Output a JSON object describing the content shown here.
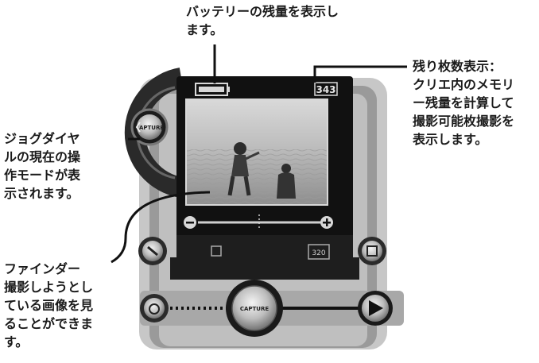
{
  "annotations": {
    "battery": "バッテリーの残量を表示し\nます。",
    "remaining": "残り枚数表示：\nクリエ内のメモリ\nー残量を計算して\n撮影可能枚撮影を\n表示します。",
    "jog_dial": "ジョグダイヤ\nルの現在の操\n作モードが表\n示されます。",
    "finder": "ファインダー\n撮影しようとし\nている画像を見\nることができま\nす。"
  },
  "device": {
    "jog_mode_text": "CAPTURE",
    "capture_button_text": "CAPTURE",
    "shots_remaining": "343",
    "resolution": "320"
  },
  "colors": {
    "device_outer": "#c7c7c7",
    "device_mid": "#9a9a9a",
    "device_dark": "#2a2a2a",
    "screen_frame": "#111111"
  }
}
